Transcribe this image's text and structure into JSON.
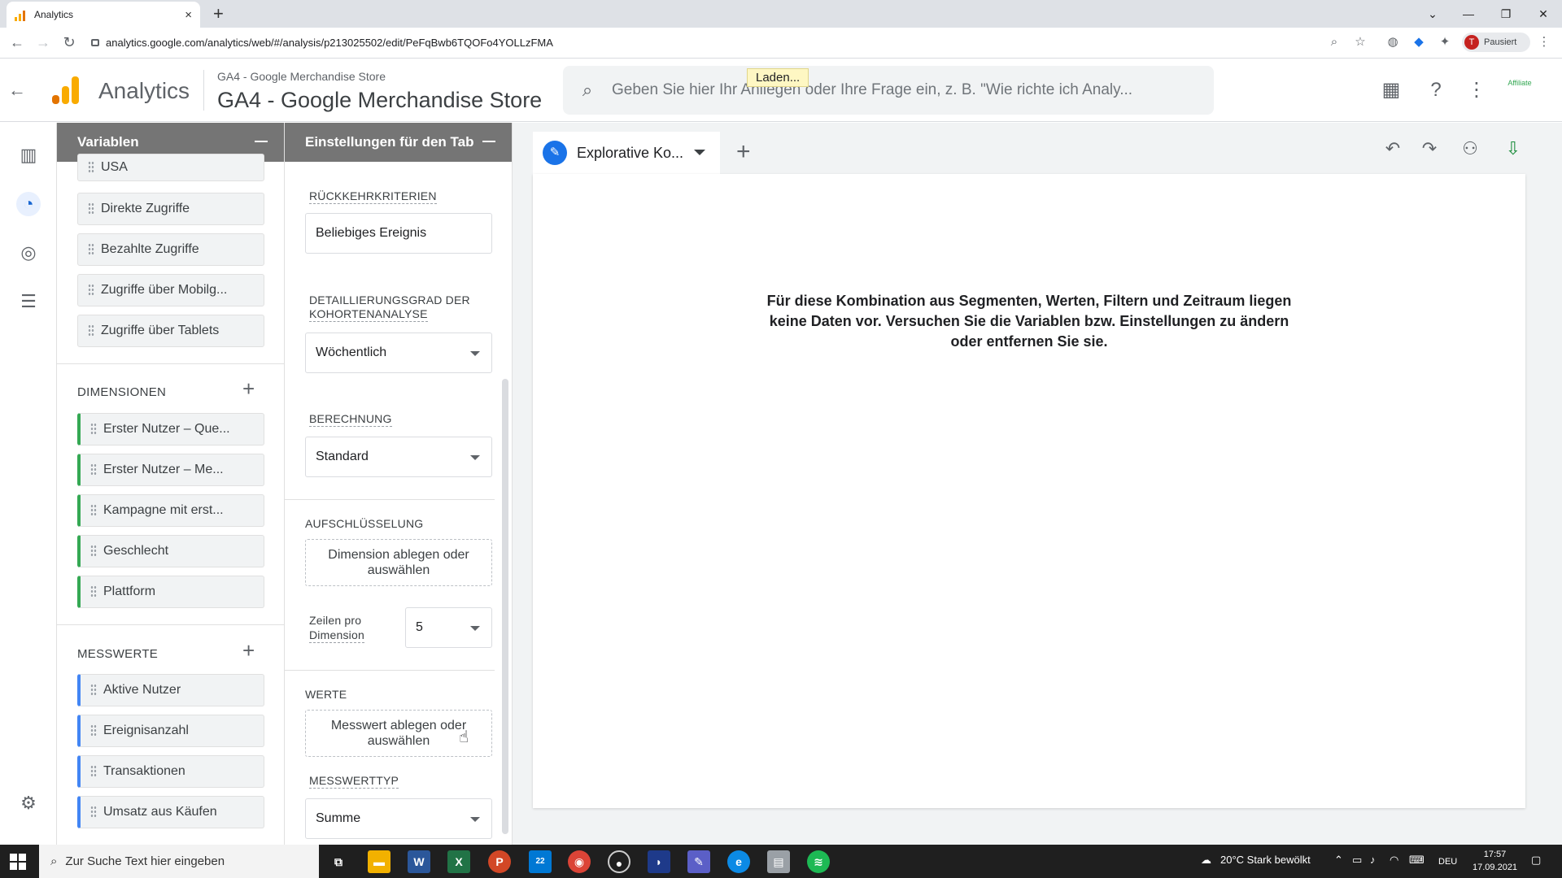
{
  "browser": {
    "tab_title": "Analytics",
    "tab_close": "×",
    "new_tab": "+",
    "url": "analytics.google.com/analytics/web/#/analysis/p213025502/edit/PeFqBwb6TQOFo4YOLLzFMA",
    "profile_initial": "T",
    "profile_label": "Pausiert"
  },
  "header": {
    "app_name": "Analytics",
    "property_sub": "GA4 - Google Merchandise Store",
    "property_main": "GA4 - Google Merchandise Store",
    "search_placeholder": "Geben Sie hier Ihr Anliegen oder Ihre Frage ein, z. B. \"Wie richte ich Analy...",
    "loading": "Laden...",
    "avatar_text": "Affiliate"
  },
  "variables_panel": {
    "title": "Variablen",
    "segments": [
      "USA",
      "Direkte Zugriffe",
      "Bezahlte Zugriffe",
      "Zugriffe über Mobilg...",
      "Zugriffe über Tablets"
    ],
    "dimensions_title": "DIMENSIONEN",
    "dimensions": [
      "Erster Nutzer – Que...",
      "Erster Nutzer – Me...",
      "Kampagne mit erst...",
      "Geschlecht",
      "Plattform"
    ],
    "metrics_title": "MESSWERTE",
    "metrics": [
      "Aktive Nutzer",
      "Ereignisanzahl",
      "Transaktionen",
      "Umsatz aus Käufen"
    ]
  },
  "tab_settings": {
    "title": "Einstellungen für den Tab",
    "return_criteria_label": "RÜCKKEHRKRITERIEN",
    "return_criteria_value": "Beliebiges Ereignis",
    "granularity_label_1": "DETAILLIERUNGSGRAD DER",
    "granularity_label_2": "KOHORTENANALYSE",
    "granularity_value": "Wöchentlich",
    "calculation_label": "BERECHNUNG",
    "calculation_value": "Standard",
    "breakdown_label": "AUFSCHLÜSSELUNG",
    "breakdown_drop": "Dimension ablegen oder auswählen",
    "rows_label_1": "Zeilen pro",
    "rows_label_2": "Dimension",
    "rows_value": "5",
    "values_label": "WERTE",
    "values_drop": "Messwert ablegen oder auswählen",
    "metric_type_label": "MESSWERTTYP",
    "metric_type_value": "Summe"
  },
  "canvas": {
    "tab_name": "Explorative Ko...",
    "no_data_message": "Für diese Kombination aus Segmenten, Werten, Filtern und Zeitraum liegen keine Daten vor. Versuchen Sie die Variablen bzw. Einstellungen zu ändern oder entfernen Sie sie."
  },
  "taskbar": {
    "search_text": "Zur Suche Text hier eingeben",
    "mail_badge": "22",
    "weather": "20°C  Stark bewölkt",
    "language": "DEU",
    "time": "17:57",
    "date": "17.09.2021"
  },
  "colors": {
    "dimension_accent": "#34a853",
    "metric_accent": "#4285f4",
    "panel_header": "#757575",
    "brand_orange": "#f9ab00"
  }
}
